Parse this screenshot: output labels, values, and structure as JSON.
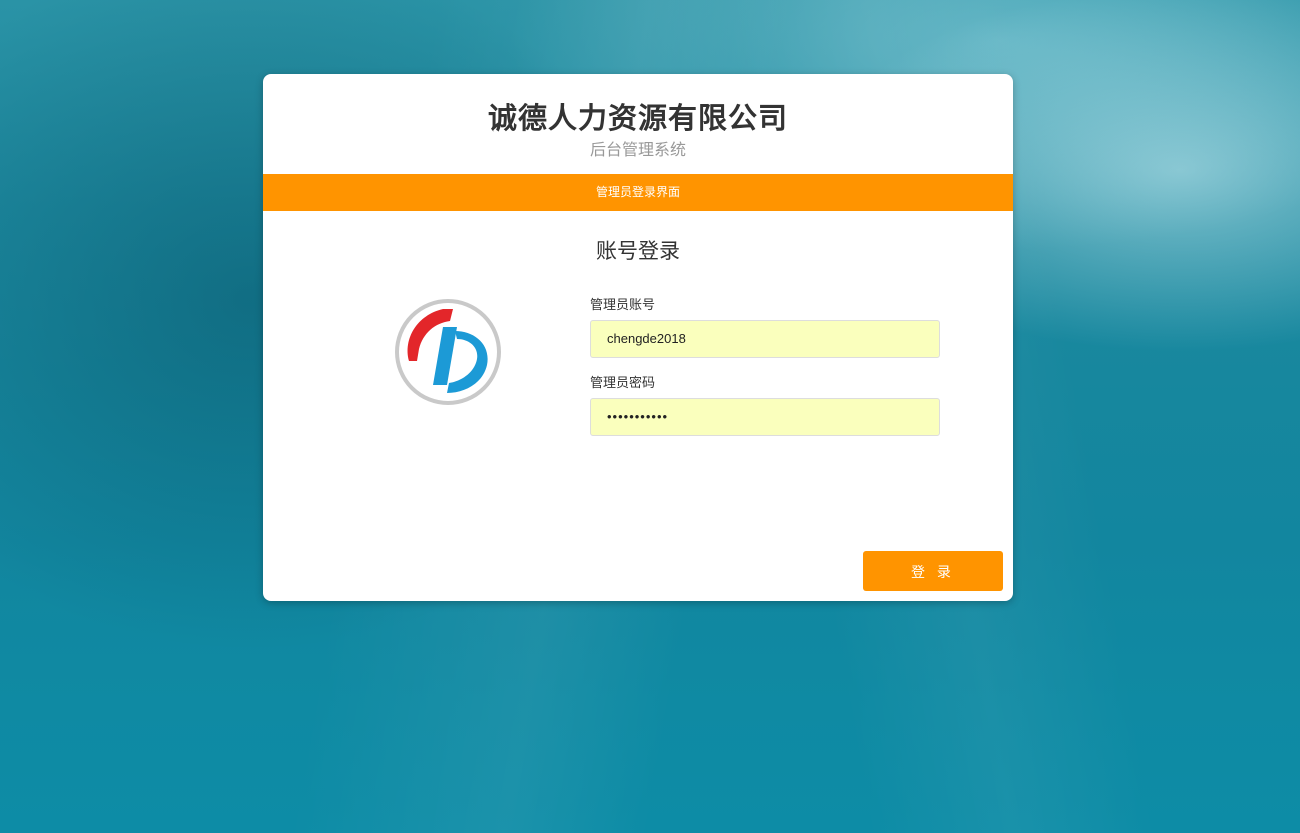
{
  "header": {
    "company_name": "诚德人力资源有限公司",
    "subtitle": "后台管理系统"
  },
  "banner": {
    "text": "管理员登录界面"
  },
  "login": {
    "title": "账号登录",
    "account_label": "管理员账号",
    "account_value": "chengde2018",
    "password_label": "管理员密码",
    "password_value": "•••••••••••",
    "submit_label": "登 录"
  },
  "colors": {
    "accent": "#ff9400",
    "autofill_bg": "#faffbd",
    "logo_red": "#e3262a",
    "logo_blue": "#1c9ad6"
  },
  "icons": {
    "logo": "company-logo"
  }
}
